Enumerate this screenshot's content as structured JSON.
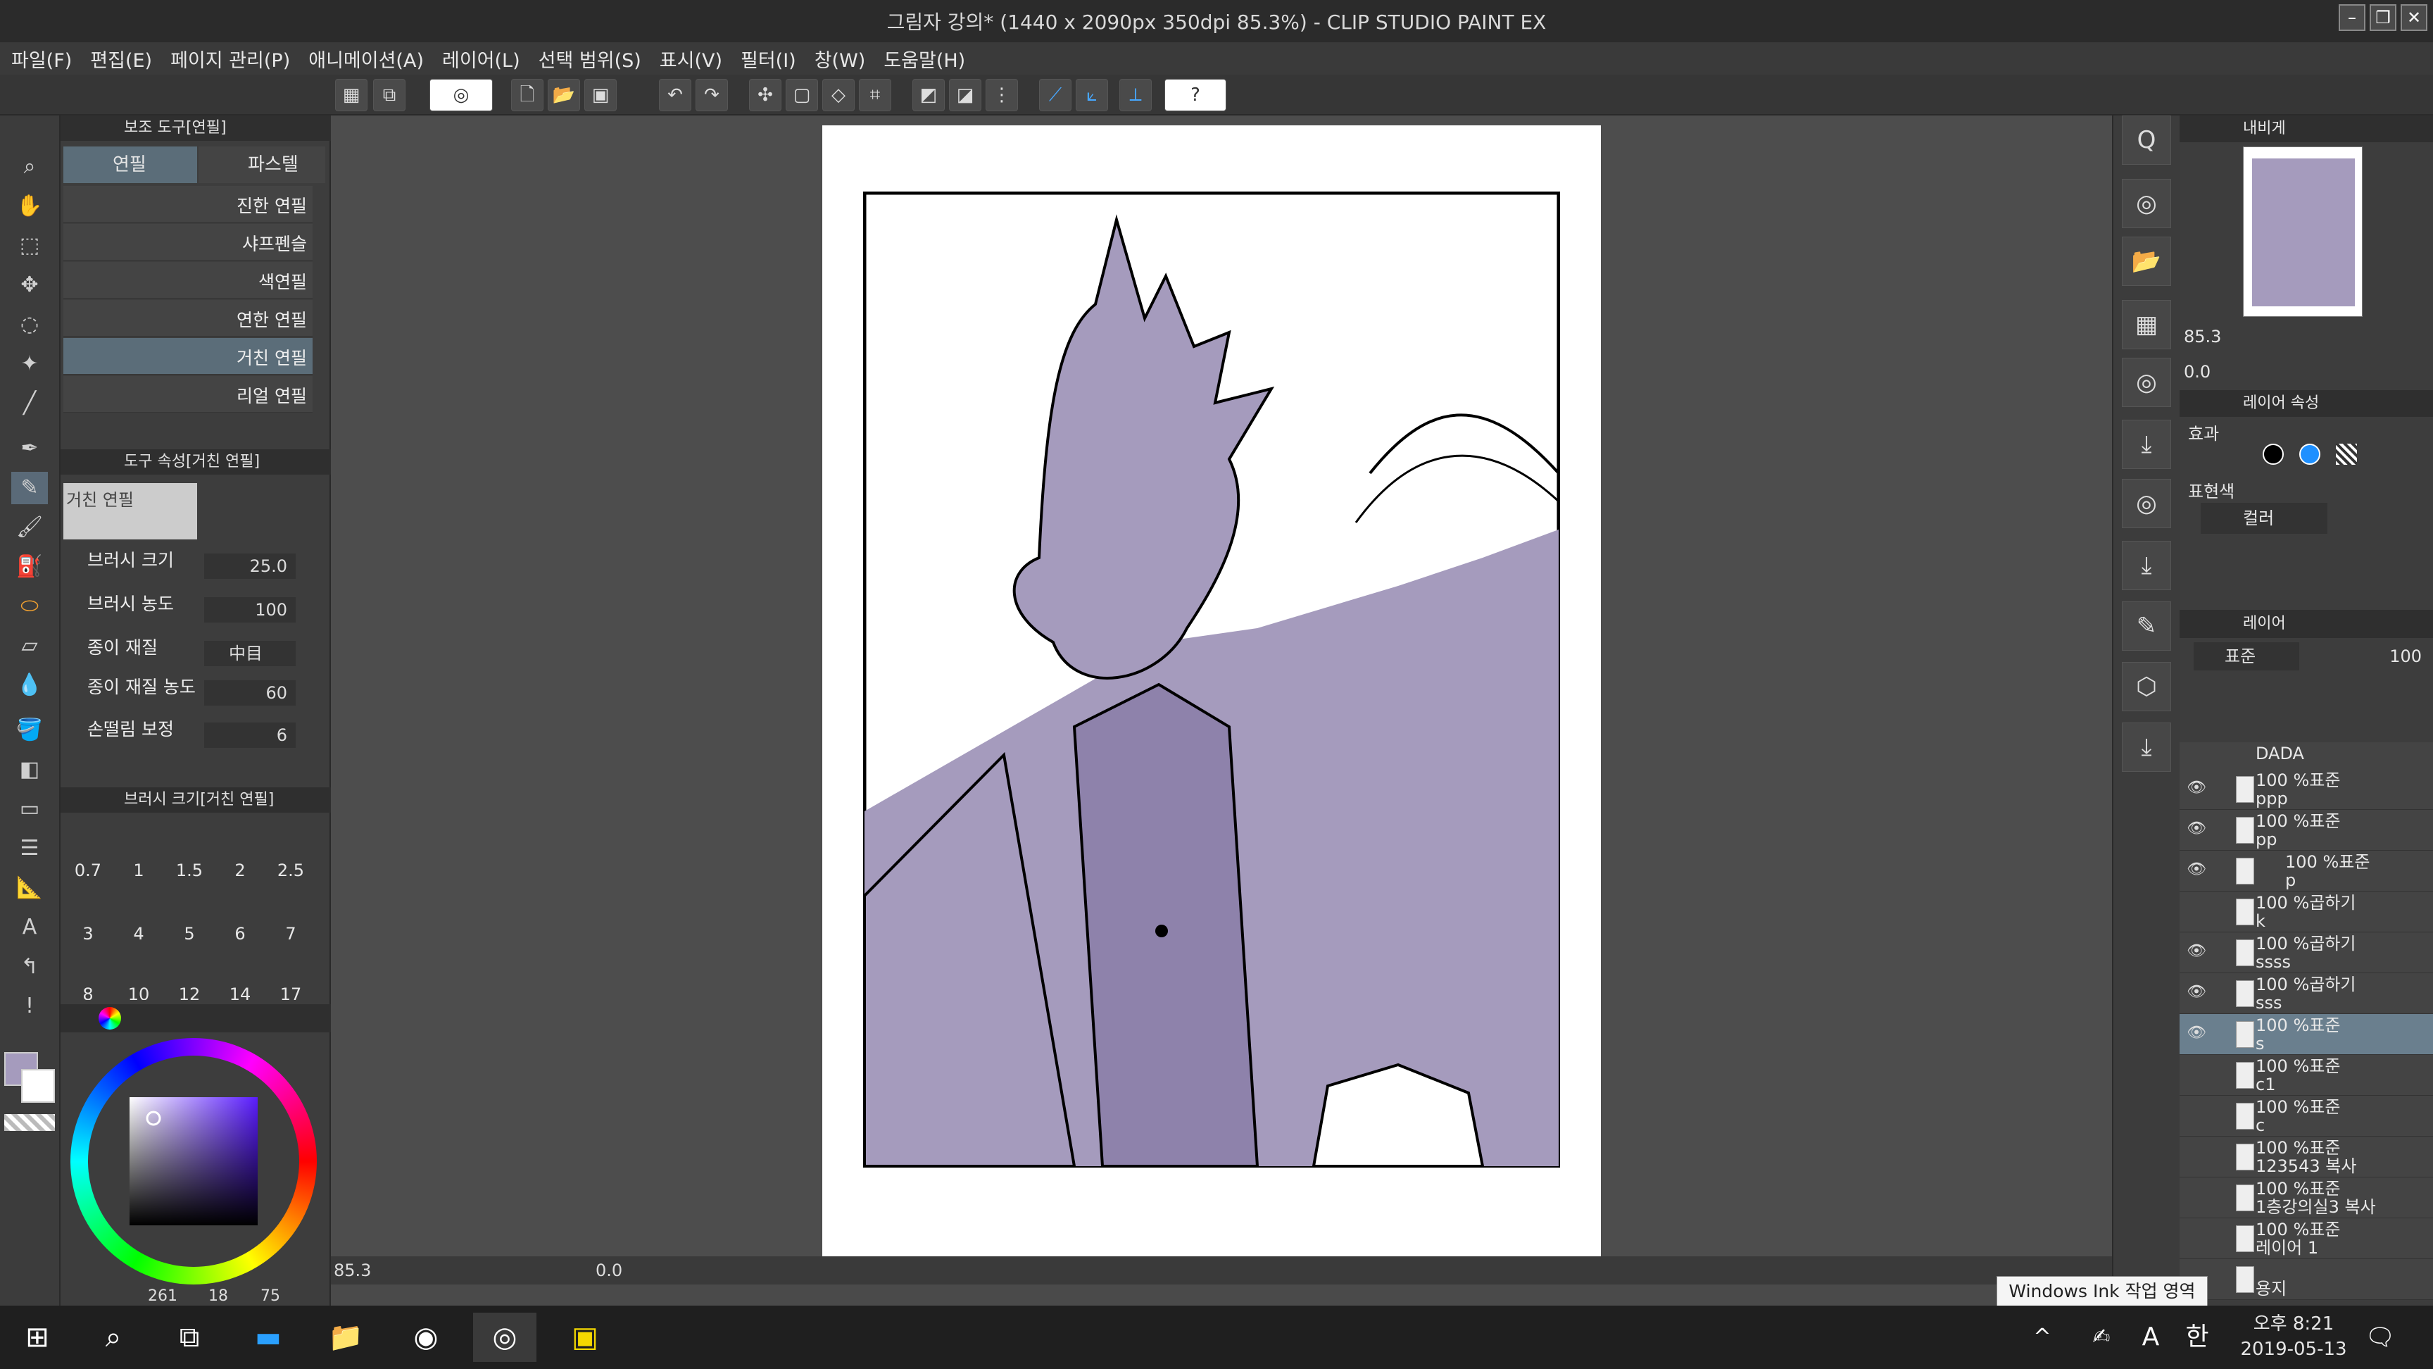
{
  "window": {
    "title": "그림자 강의* (1440 x 2090px 350dpi 85.3%)  - CLIP STUDIO PAINT EX"
  },
  "menu": [
    "파일(F)",
    "편집(E)",
    "페이지 관리(P)",
    "애니메이션(A)",
    "레이어(L)",
    "선택 범위(S)",
    "표시(V)",
    "필터(I)",
    "창(W)",
    "도움말(H)"
  ],
  "subtool": {
    "header": "보조 도구[연필]",
    "tabs": [
      "연필",
      "파스텔"
    ],
    "brushes": [
      "진한 연필",
      "샤프펜슬",
      "색연필",
      "연한 연필",
      "거친 연필",
      "리얼 연필"
    ],
    "selected": "거친 연필"
  },
  "tool_property": {
    "header": "도구 속성[거친 연필]",
    "preview_label": "거친 연필",
    "props": [
      {
        "label": "브러시 크기",
        "value": "25.0"
      },
      {
        "label": "브러시 농도",
        "value": "100"
      },
      {
        "label": "종이 재질",
        "value": "中目"
      },
      {
        "label": "종이 재질 농도",
        "value": "60"
      },
      {
        "label": "손떨림 보정",
        "value": "6"
      }
    ]
  },
  "brush_size": {
    "header": "브러시 크기[거친 연필]",
    "sizes": [
      "0.7",
      "1",
      "1.5",
      "2",
      "2.5",
      "3",
      "4",
      "5",
      "6",
      "7",
      "8",
      "10",
      "12",
      "14",
      "17"
    ]
  },
  "color": {
    "h": "261",
    "s": "18",
    "v": "75",
    "main": "#a59bbd",
    "accent": "#47a7ff"
  },
  "navigator": {
    "tab": "내비게",
    "zoom": "85.3",
    "rotate": "0.0"
  },
  "layer_property": {
    "tab": "레이어 속성",
    "effect_label": "효과",
    "expression_label": "표현색",
    "expression_value": "컬러"
  },
  "layers_panel": {
    "tab": "레이어",
    "blend": "표준",
    "opacity": "100",
    "layers": [
      {
        "l1": "DADA",
        "l2": "",
        "eye": false
      },
      {
        "l1": "100 %표준",
        "l2": "ppp",
        "eye": true
      },
      {
        "l1": "100 %표준",
        "l2": "pp",
        "eye": true
      },
      {
        "l1": "100 %표준",
        "l2": "p",
        "eye": true
      },
      {
        "l1": "100 %곱하기",
        "l2": "k",
        "eye": false
      },
      {
        "l1": "100 %곱하기",
        "l2": "ssss",
        "eye": true
      },
      {
        "l1": "100 %곱하기",
        "l2": "sss",
        "eye": true
      },
      {
        "l1": "100 %표준",
        "l2": "s",
        "eye": true,
        "selected": true
      },
      {
        "l1": "100 %표준",
        "l2": "c1",
        "eye": false
      },
      {
        "l1": "100 %표준",
        "l2": "c",
        "eye": false
      },
      {
        "l1": "100 %표준",
        "l2": "123543 복사",
        "eye": false
      },
      {
        "l1": "100 %표준",
        "l2": "1층강의실3 복사",
        "eye": false
      },
      {
        "l1": "100 %표준",
        "l2": "레이어 1",
        "eye": false
      },
      {
        "l1": "용지",
        "l2": "",
        "eye": false
      }
    ]
  },
  "statusbar": {
    "zoom": "85.3",
    "angle": "0.0"
  },
  "tooltip": "Windows Ink 작업 영역",
  "taskbar": {
    "time": "오후 8:21",
    "date": "2019-05-13",
    "ime1": "A",
    "ime2": "한"
  }
}
